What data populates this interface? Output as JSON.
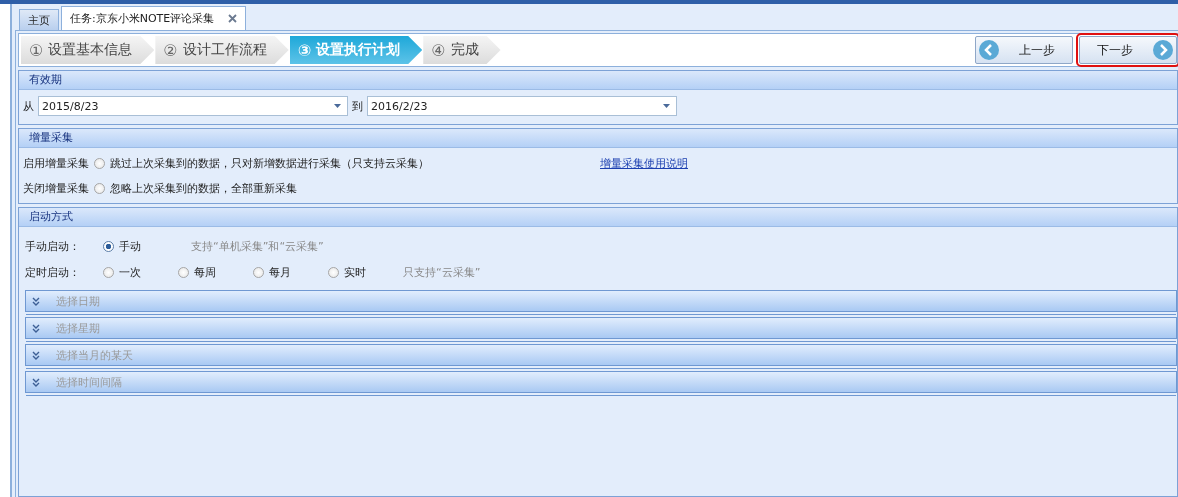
{
  "tabs": [
    {
      "label": "主页",
      "selected": false,
      "closable": false
    },
    {
      "label": "任务:京东小米NOTE评论采集",
      "selected": true,
      "closable": true
    }
  ],
  "steps": [
    {
      "number": "①",
      "label": "设置基本信息",
      "selected": false
    },
    {
      "number": "②",
      "label": "设计工作流程",
      "selected": false
    },
    {
      "number": "③",
      "label": "设置执行计划",
      "selected": true
    },
    {
      "number": "④",
      "label": "完成",
      "selected": false
    }
  ],
  "nav_buttons": [
    {
      "label": "上一步",
      "kind": "prev",
      "highlighted": false
    },
    {
      "label": "下一步",
      "kind": "next",
      "highlighted": true
    }
  ],
  "validity": {
    "title": "有效期",
    "from_label": "从",
    "from_value": "2015/8/23",
    "to_label": "到",
    "to_value": "2016/2/23"
  },
  "incremental": {
    "title": "增量采集",
    "options": [
      {
        "label": "启用增量采集",
        "text": "跳过上次采集到的数据，只对新增数据进行采集（只支持云采集）",
        "selected": false
      },
      {
        "label": "关闭增量采集",
        "text": "忽略上次采集到的数据，全部重新采集",
        "selected": false
      }
    ],
    "help_link": "增量采集使用说明"
  },
  "start": {
    "title": "启动方式",
    "rows": [
      {
        "label": "手动启动：",
        "options": [
          {
            "label": "手动",
            "selected": true
          }
        ],
        "note": "支持“单机采集”和“云采集”"
      },
      {
        "label": "定时启动：",
        "options": [
          {
            "label": "一次",
            "selected": false
          },
          {
            "label": "每周",
            "selected": false
          },
          {
            "label": "每月",
            "selected": false
          },
          {
            "label": "实时",
            "selected": false
          }
        ],
        "note": "只支持“云采集”"
      }
    ]
  },
  "panels": [
    {
      "title": "选择日期",
      "expanded": false
    },
    {
      "title": "选择星期",
      "expanded": false
    },
    {
      "title": "选择当月的某天",
      "expanded": false
    },
    {
      "title": "选择时间间隔",
      "expanded": false
    }
  ]
}
